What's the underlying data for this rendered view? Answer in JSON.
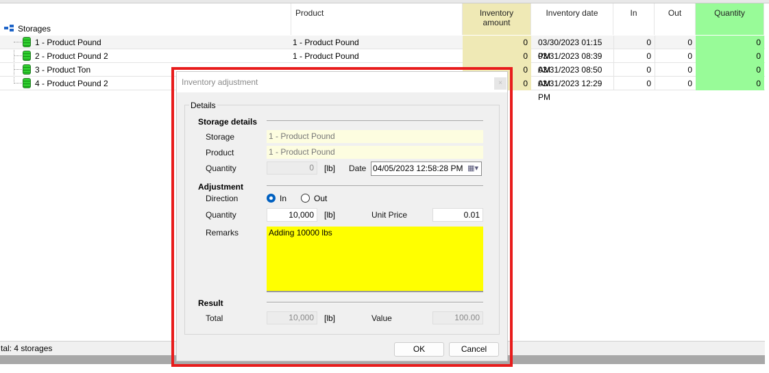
{
  "grid": {
    "columns": [
      "Product",
      "Inventory amount",
      "Inventory date",
      "In",
      "Out",
      "Quantity"
    ],
    "root": "Storages",
    "rows": [
      {
        "storage": "1 - Product Pound",
        "product": "1 - Product Pound",
        "amount": "0",
        "date": "03/30/2023 01:15 PM",
        "in": "0",
        "out": "0",
        "quantity": "0"
      },
      {
        "storage": "2 - Product Pound 2",
        "product": "1 - Product Pound",
        "amount": "0",
        "date": "03/31/2023 08:39 AM",
        "in": "0",
        "out": "0",
        "quantity": "0"
      },
      {
        "storage": "3 - Product Ton",
        "product": "",
        "amount": "0",
        "date": "03/31/2023 08:50 AM",
        "in": "0",
        "out": "0",
        "quantity": "0"
      },
      {
        "storage": "4 - Product Pound 2",
        "product": "",
        "amount": "0",
        "date": "03/31/2023 12:29 PM",
        "in": "0",
        "out": "0",
        "quantity": "0"
      }
    ],
    "colors": {
      "inventory_amount": "#efe9b5",
      "quantity": "#98fb98"
    }
  },
  "status": "tal: 4 storages",
  "dialog": {
    "title": "Inventory adjustment",
    "close": "×",
    "group": "Details",
    "storage_section": "Storage details",
    "storage_label": "Storage",
    "storage_value": "1 - Product Pound",
    "product_label": "Product",
    "product_value": "1 - Product Pound",
    "quantity_label": "Quantity",
    "quantity_value": "0",
    "unit": "[lb]",
    "date_label": "Date",
    "date_value": "04/05/2023 12:58:28 PM",
    "adjustment_section": "Adjustment",
    "direction_label": "Direction",
    "dir_in": "In",
    "dir_out": "Out",
    "direction_selected": "In",
    "adj_quantity_label": "Quantity",
    "adj_quantity_value": "10,000",
    "unit_price_label": "Unit Price",
    "unit_price_value": "0.01",
    "remarks_label": "Remarks",
    "remarks_value": "Adding 10000 lbs",
    "remarks_color": "#ffff00",
    "result_section": "Result",
    "total_label": "Total",
    "total_value": "10,000",
    "value_label": "Value",
    "value_value": "100.00",
    "ok": "OK",
    "cancel": "Cancel"
  }
}
